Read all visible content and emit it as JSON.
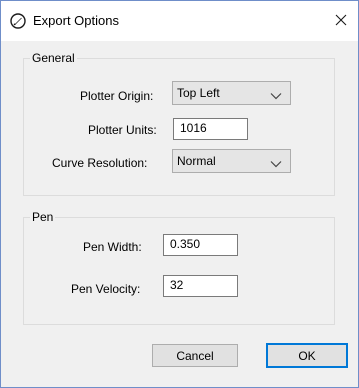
{
  "window": {
    "title": "Export Options",
    "app_icon": "pen-nib-icon",
    "close_icon": "close-icon"
  },
  "general": {
    "legend": "General",
    "plotter_origin": {
      "label": "Plotter Origin:",
      "value": "Top Left"
    },
    "plotter_units": {
      "label": "Plotter Units:",
      "value": "1016"
    },
    "curve_resolution": {
      "label": "Curve Resolution:",
      "value": "Normal"
    }
  },
  "pen": {
    "legend": "Pen",
    "pen_width": {
      "label": "Pen Width:",
      "value": "0.350"
    },
    "pen_velocity": {
      "label": "Pen Velocity:",
      "value": "32"
    }
  },
  "buttons": {
    "cancel": "Cancel",
    "ok": "OK"
  },
  "colors": {
    "window_border": "#6f8ec9",
    "default_button_border": "#0078d7",
    "dialog_background": "#f0f0f0"
  }
}
